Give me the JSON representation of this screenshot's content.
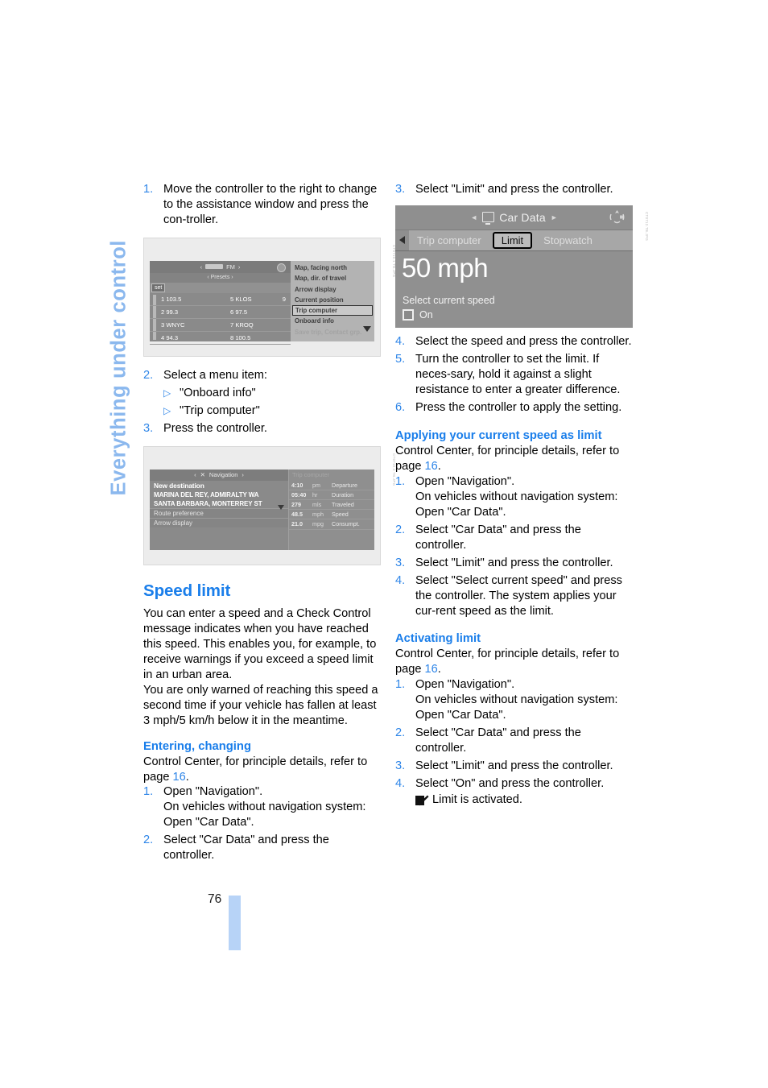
{
  "chapter_tab": "Everything under control",
  "page_number": "76",
  "left_column": {
    "steps_top": [
      {
        "num": "1.",
        "text": "Move the controller to the right to change to the assistance window and press the con-troller."
      }
    ],
    "figure_radio": {
      "caption": "CT0710.1 TB.JPG",
      "header_label": "FM",
      "presets_label": "Presets",
      "set_label": "set",
      "presets": [
        {
          "left": "1 103.5",
          "mid": "5 KLOS",
          "right": "9"
        },
        {
          "left": "2 99.3",
          "mid": "6 97.5",
          "right": ""
        },
        {
          "left": "3 WNYC",
          "mid": "7 KROQ",
          "right": ""
        },
        {
          "left": "4 94.3",
          "mid": "8 100.5",
          "right": ""
        }
      ],
      "menu": [
        "Map, facing north",
        "Map, dir. of travel",
        "Arrow display",
        "Current position",
        "Trip computer",
        "Onboard info",
        "Save trip, Contact grp."
      ],
      "menu_selected": "Trip computer"
    },
    "step2": {
      "num": "2.",
      "text": "Select a menu item:"
    },
    "sub_items": [
      "\"Onboard info\"",
      "\"Trip computer\""
    ],
    "step3": {
      "num": "3.",
      "text": "Press the controller."
    },
    "figure_nav": {
      "caption": "CT0710.2 TB.JPG",
      "title": "Navigation",
      "right_title": "Trip computer",
      "entries": [
        "New destination",
        "MARINA DEL REY, ADMIRALTY WA",
        "SANTA BARBARA, MONTERREY ST"
      ],
      "options": [
        "Route preference",
        "Arrow display"
      ],
      "trip_rows": [
        {
          "value": "4:10",
          "unit": "pm",
          "label": "Departure"
        },
        {
          "value": "05:40",
          "unit": "hr",
          "label": "Duration"
        },
        {
          "value": "279",
          "unit": "mls",
          "label": "Traveled"
        },
        {
          "value": "48.5",
          "unit": "mph",
          "label": "Speed"
        },
        {
          "value": "21.0",
          "unit": "mpg",
          "label": "Consumpt."
        }
      ]
    },
    "speed_limit": {
      "heading": "Speed limit",
      "paragraph1": "You can enter a speed and a Check Control message indicates when you have reached this speed. This enables you, for example, to receive warnings if you exceed a speed limit in an urban area.",
      "paragraph2": "You are only warned of reaching this speed a second time if your vehicle has fallen at least 3 mph/5 km/h below it in the meantime."
    },
    "entering_changing": {
      "heading": "Entering, changing",
      "lead_pre": "Control Center, for principle details, refer to page ",
      "lead_page": "16",
      "lead_post": ".",
      "steps": [
        {
          "num": "1.",
          "text": "Open \"Navigation\".\nOn vehicles without navigation system:\nOpen \"Car Data\"."
        },
        {
          "num": "2.",
          "text": "Select \"Car Data\" and press the controller."
        }
      ]
    }
  },
  "right_column": {
    "step3": {
      "num": "3.",
      "text": "Select \"Limit\" and press the controller."
    },
    "figure_cardata": {
      "caption": "CT0712.TB.JPG",
      "title": "Car Data",
      "tabs": [
        "Trip computer",
        "Limit",
        "Stopwatch"
      ],
      "selected_tab": "Limit",
      "speed_value": "50 mph",
      "select_label": "Select current speed",
      "on_label": "On"
    },
    "steps_456": [
      {
        "num": "4.",
        "text": "Select the speed and press the controller."
      },
      {
        "num": "5.",
        "text": "Turn the controller to set the limit. If neces-sary, hold it against a slight resistance to enter a greater difference."
      },
      {
        "num": "6.",
        "text": "Press the controller to apply the setting."
      }
    ],
    "applying": {
      "heading": "Applying your current speed as limit",
      "lead_pre": "Control Center, for principle details, refer to page ",
      "lead_page": "16",
      "lead_post": ".",
      "steps": [
        {
          "num": "1.",
          "text": "Open \"Navigation\".\nOn vehicles without navigation system:\nOpen \"Car Data\"."
        },
        {
          "num": "2.",
          "text": "Select \"Car Data\" and press the controller."
        },
        {
          "num": "3.",
          "text": "Select \"Limit\" and press the controller."
        },
        {
          "num": "4.",
          "text": "Select \"Select current speed\" and press the controller. The system applies your cur-rent speed as the limit."
        }
      ]
    },
    "activating": {
      "heading": "Activating limit",
      "lead_pre": "Control Center, for principle details, refer to page ",
      "lead_page": "16",
      "lead_post": ".",
      "steps": [
        {
          "num": "1.",
          "text": "Open \"Navigation\".\nOn vehicles without navigation system:\nOpen \"Car Data\"."
        },
        {
          "num": "2.",
          "text": "Select \"Car Data\" and press the controller."
        },
        {
          "num": "3.",
          "text": "Select \"Limit\" and press the controller."
        },
        {
          "num": "4.",
          "text": "Select \"On\" and press the controller."
        }
      ],
      "check_text": "Limit is activated."
    }
  },
  "colors": {
    "accent_blue": "#1a7eea",
    "step_blue": "#2f86e8",
    "tab_blue": "#8bb8ee",
    "page_bar_blue": "#b7d3f7"
  }
}
